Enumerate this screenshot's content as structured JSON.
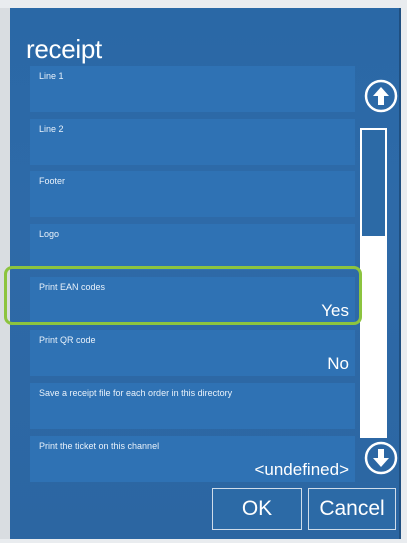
{
  "dialog": {
    "title": "receipt"
  },
  "rows": [
    {
      "label": "Line 1",
      "value": ""
    },
    {
      "label": "Line 2",
      "value": ""
    },
    {
      "label": "Footer",
      "value": ""
    },
    {
      "label": "Logo",
      "value": ""
    },
    {
      "label": "Print EAN codes",
      "value": "Yes"
    },
    {
      "label": "Print QR code",
      "value": "No"
    },
    {
      "label": "Save a receipt file for each order in this directory",
      "value": ""
    },
    {
      "label": "Print the ticket on this channel",
      "value": "<undefined>"
    }
  ],
  "buttons": {
    "ok": "OK",
    "cancel": "Cancel"
  },
  "icons": {
    "scroll_up": "arrow-up-circle-icon",
    "scroll_down": "arrow-down-circle-icon"
  },
  "colors": {
    "dialog_bg": "#2a68a6",
    "row_bg": "#2f72b4",
    "highlight": "#8cc43f",
    "text": "#ffffff"
  }
}
